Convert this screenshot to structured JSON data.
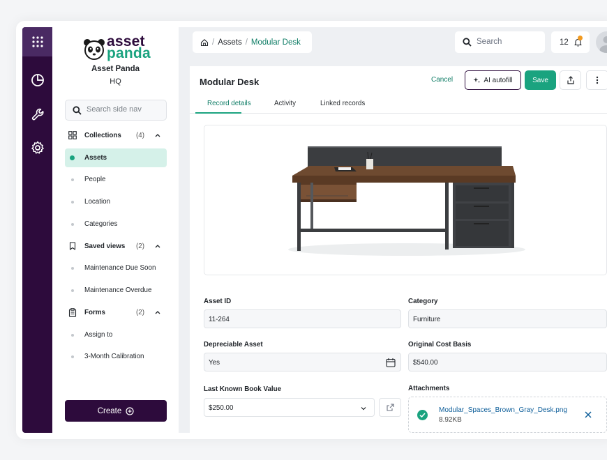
{
  "org": {
    "logo_line1": "asset",
    "logo_line2": "panda",
    "name": "Asset Panda",
    "subtitle": "HQ"
  },
  "sidenav": {
    "search_placeholder": "Search side nav",
    "items": [
      {
        "label": "Collections",
        "count": "(4)",
        "kind": "group"
      },
      {
        "label": "Assets",
        "kind": "item",
        "active": true
      },
      {
        "label": "People",
        "kind": "item"
      },
      {
        "label": "Location",
        "kind": "item"
      },
      {
        "label": "Categories",
        "kind": "item"
      },
      {
        "label": "Saved views",
        "count": "(2)",
        "kind": "group"
      },
      {
        "label": "Maintenance Due Soon",
        "kind": "item"
      },
      {
        "label": "Maintenance Overdue",
        "kind": "item"
      },
      {
        "label": "Forms",
        "count": "(2)",
        "kind": "group"
      },
      {
        "label": "Assign to",
        "kind": "item"
      },
      {
        "label": "3-Month Calibration",
        "kind": "item"
      }
    ],
    "create_label": "Create"
  },
  "header": {
    "breadcrumb": {
      "root": "Assets",
      "sep": "/",
      "current": "Modular Desk"
    },
    "search_placeholder": "Search",
    "notification_count": "12"
  },
  "record": {
    "title": "Modular Desk",
    "cancel_label": "Cancel",
    "ai_label": "AI autofill",
    "save_label": "Save",
    "tabs": [
      "Record details",
      "Activity",
      "Linked records"
    ],
    "fields": {
      "asset_id": {
        "label": "Asset ID",
        "value": "11-264"
      },
      "category": {
        "label": "Category",
        "value": "Furniture"
      },
      "depreciable": {
        "label": "Depreciable Asset",
        "value": "Yes"
      },
      "cost_basis": {
        "label": "Original Cost Basis",
        "value": "$540.00"
      },
      "book_value": {
        "label": "Last Known Book Value",
        "value": "$250.00"
      },
      "attachments": {
        "label": "Attachments",
        "file_name": "Modular_Spaces_Brown_Gray_Desk.png",
        "file_size": "8.92KB"
      }
    }
  },
  "colors": {
    "brand_dark": "#2d0b3c",
    "accent": "#1aa37f",
    "notification": "#f29a1f"
  },
  "icons": [
    "apps-grid-icon",
    "pie-chart-icon",
    "wrench-icon",
    "gear-icon",
    "search-icon",
    "home-icon",
    "bell-icon",
    "sparkle-icon",
    "share-icon",
    "more-vertical-icon",
    "calendar-icon",
    "chevron-down-icon",
    "external-link-icon",
    "check-icon",
    "close-icon",
    "plus-circle-icon"
  ]
}
